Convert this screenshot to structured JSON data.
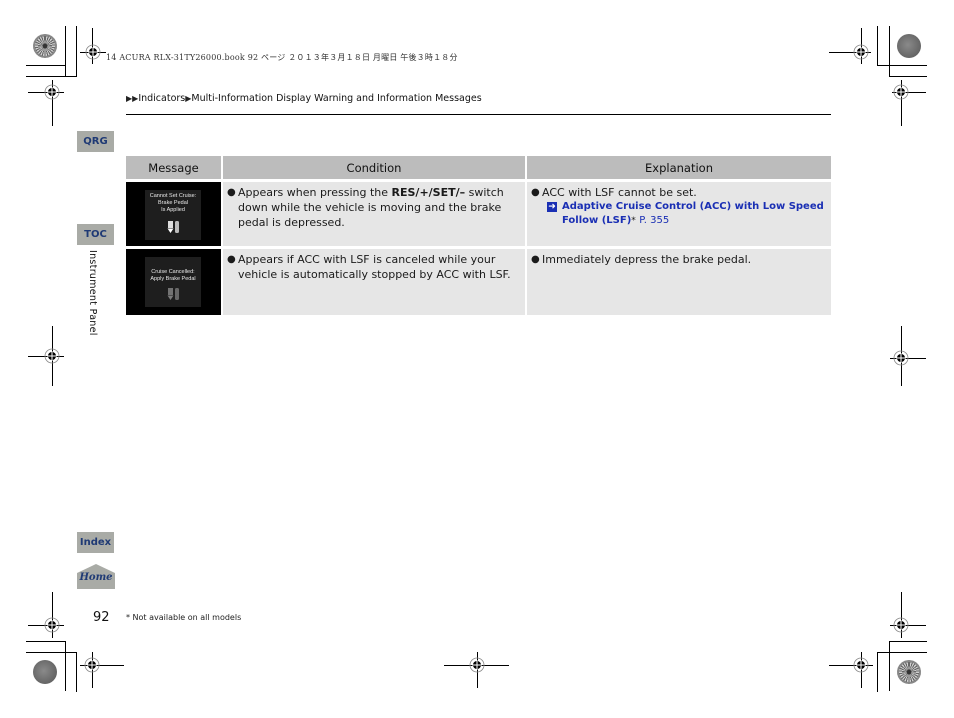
{
  "print_header": "14 ACURA RLX-31TY26000.book  92 ページ  ２０１３年３月１８日  月曜日  午後３時１８分",
  "breadcrumb": {
    "prefix_icon": "double-triangle-right",
    "items": [
      "Indicators",
      "Multi-Information Display Warning and Information Messages"
    ],
    "separator_icon": "triangle-right"
  },
  "side_nav": {
    "qrg": "QRG",
    "toc": "TOC",
    "index": "Index",
    "home": "Home",
    "section": "Instrument Panel"
  },
  "table": {
    "headers": [
      "Message",
      "Condition",
      "Explanation"
    ],
    "rows": [
      {
        "display_image": {
          "lines": [
            "Cannot Set Cruise:",
            "Brake Pedal",
            "Is Applied"
          ],
          "icon": "brake-pedal-icon"
        },
        "condition": {
          "pre": "Appears when pressing the ",
          "bold": "RES/+/SET/–",
          "post": " switch down while the vehicle is moving and the brake pedal is depressed."
        },
        "explanation": {
          "text": "ACC with LSF cannot be set.",
          "reference": {
            "icon": "arrow-right-icon",
            "title": "Adaptive Cruise Control (ACC) with Low Speed Follow (LSF)",
            "asterisk": "*",
            "page": "P. 355"
          }
        }
      },
      {
        "display_image": {
          "lines": [
            "Cruise Cancelled:",
            "Apply Brake Pedal"
          ],
          "icon": "brake-pedal-icon"
        },
        "condition": {
          "pre": "Appears if ACC with LSF is canceled while your vehicle is automatically stopped by ACC with LSF.",
          "bold": "",
          "post": ""
        },
        "explanation": {
          "text": "Immediately depress the brake pedal."
        }
      }
    ]
  },
  "footer": {
    "page_number": "92",
    "footnote": "* Not available on all models"
  },
  "colors": {
    "nav_button_bg": "#a9aba6",
    "nav_button_text": "#1f3a75",
    "header_bg": "#bcbcbc",
    "cell_bg": "#e6e6e6",
    "link": "#1a2fb4"
  }
}
